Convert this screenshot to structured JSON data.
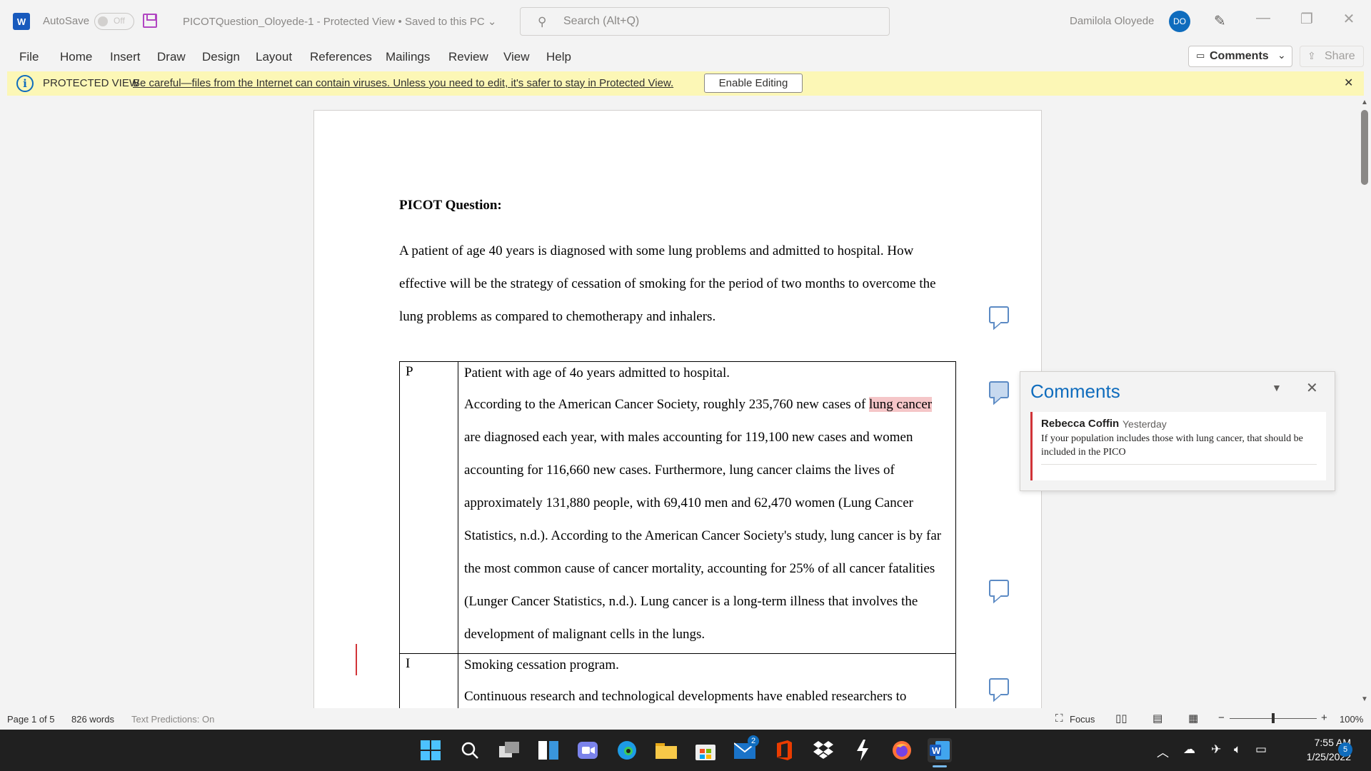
{
  "titlebar": {
    "autosave_label": "AutoSave",
    "autosave_state": "Off",
    "doc_title": "PICOTQuestion_Oloyede-1  -  Protected View • Saved to this PC  ⌄",
    "search_placeholder": "Search (Alt+Q)",
    "user_name": "Damilola  Oloyede",
    "user_initials": "DO"
  },
  "menu": {
    "items": [
      "File",
      "Home",
      "Insert",
      "Draw",
      "Design",
      "Layout",
      "References",
      "Mailings",
      "Review",
      "View",
      "Help"
    ],
    "comments_label": "Comments",
    "share_label": "Share"
  },
  "protected_view": {
    "label": "PROTECTED VIEW",
    "message": "Be careful—files from the Internet can contain viruses. Unless you need to edit, it's safer to stay in Protected View.",
    "enable_label": "Enable Editing"
  },
  "document": {
    "heading": "PICOT Question:",
    "paragraph": "A patient of age 40 years is diagnosed with some lung problems and admitted to hospital. How effective will be the strategy of cessation of smoking for the period of two months to overcome the lung problems as compared to chemotherapy and inhalers.",
    "table": {
      "p_key": "P",
      "p_first": "Patient with age of 4o years admitted to hospital.",
      "p_body_before": "According to the American Cancer Society, roughly 235,760 new cases of ",
      "p_highlight": "lung cancer ",
      "p_body_after": "are diagnosed each year, with males accounting for 119,100 new cases and women accounting for 116,660 new cases. Furthermore, lung cancer claims the lives of approximately 131,880 people, with 69,410 men and 62,470 women (Lung Cancer Statistics, n.d.). According to the American Cancer Society's study, lung cancer is by far the most common cause of cancer mortality, accounting for 25% of all cancer fatalities (Lunger Cancer Statistics, n.d.). Lung cancer is a long-term illness that involves the development of malignant cells in the lungs.",
      "i_key": "I",
      "i_first": "Smoking cessation program.",
      "i_body": "Continuous research and technological developments have enabled researchers to"
    }
  },
  "comments_pane": {
    "title": "Comments",
    "author": "Rebecca Coffin",
    "time": "Yesterday",
    "body": "If your population includes those with lung cancer, that should be included in the PICO"
  },
  "statusbar": {
    "page": "Page 1 of 5",
    "words": "826 words",
    "predictions": "Text Predictions: On",
    "focus": "Focus",
    "zoom": "100%",
    "zoom_value": 100
  },
  "taskbar": {
    "time": "7:55 AM",
    "date": "1/25/2022",
    "notification_count": "5",
    "mail_badge": "2"
  }
}
